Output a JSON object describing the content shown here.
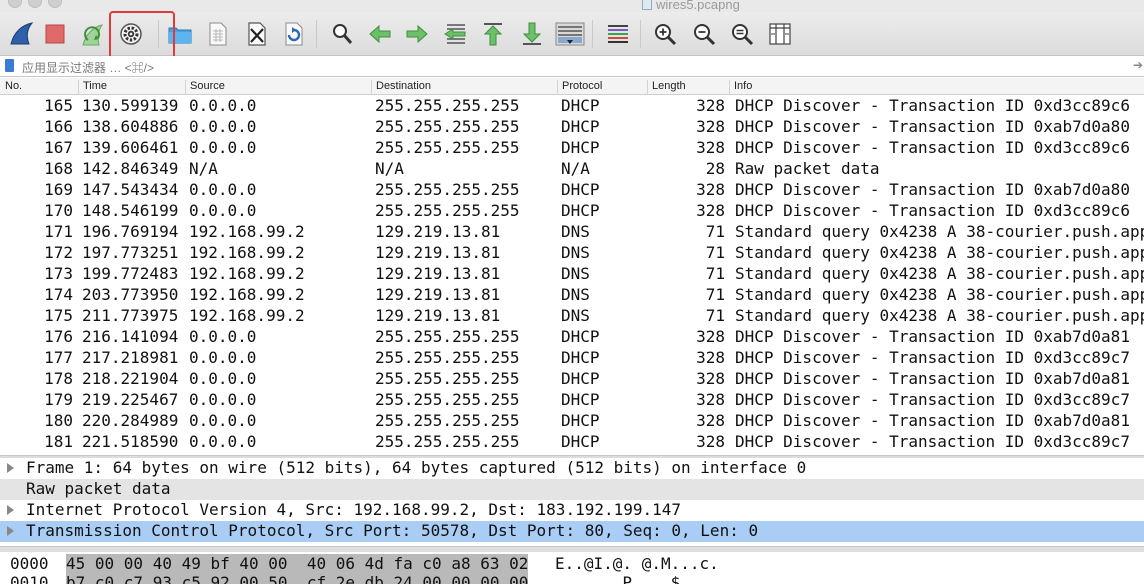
{
  "window": {
    "title": "wires5.pcapng"
  },
  "toolbar": {
    "buttons": [
      {
        "name": "start-capture-icon",
        "glyph": "shark-fin"
      },
      {
        "name": "stop-capture-icon",
        "glyph": "stop-square"
      },
      {
        "name": "restart-capture-icon",
        "glyph": "restart-fin"
      },
      {
        "name": "capture-options-icon",
        "glyph": "gear"
      },
      {
        "name": "open-file-icon",
        "glyph": "folder"
      },
      {
        "name": "save-file-icon",
        "glyph": "document"
      },
      {
        "name": "close-file-icon",
        "glyph": "document-x"
      },
      {
        "name": "reload-file-icon",
        "glyph": "document-reload"
      },
      {
        "name": "find-packet-icon",
        "glyph": "magnifier"
      },
      {
        "name": "go-back-icon",
        "glyph": "arrow-left"
      },
      {
        "name": "go-forward-icon",
        "glyph": "arrow-right"
      },
      {
        "name": "go-to-packet-icon",
        "glyph": "arrow-jump"
      },
      {
        "name": "go-first-packet-icon",
        "glyph": "arrow-up-top"
      },
      {
        "name": "go-last-packet-icon",
        "glyph": "arrow-down-bottom"
      },
      {
        "name": "auto-scroll-icon",
        "glyph": "list-scroll"
      },
      {
        "name": "colorize-icon",
        "glyph": "color-lines"
      },
      {
        "name": "zoom-in-icon",
        "glyph": "zoom-plus"
      },
      {
        "name": "zoom-out-icon",
        "glyph": "zoom-minus"
      },
      {
        "name": "normal-size-icon",
        "glyph": "zoom-equal"
      },
      {
        "name": "resize-columns-icon",
        "glyph": "columns"
      }
    ],
    "highlight_color": "#e23a3a"
  },
  "filter": {
    "placeholder": "应用显示过滤器 … <⌘/>"
  },
  "columns": {
    "no": "No.",
    "time": "Time",
    "source": "Source",
    "destination": "Destination",
    "protocol": "Protocol",
    "length": "Length",
    "info": "Info"
  },
  "packets": [
    {
      "no": "165",
      "time": "130.599139",
      "src": "0.0.0.0",
      "dst": "255.255.255.255",
      "proto": "DHCP",
      "len": "328",
      "info": "DHCP Discover - Transaction ID 0xd3cc89c6"
    },
    {
      "no": "166",
      "time": "138.604886",
      "src": "0.0.0.0",
      "dst": "255.255.255.255",
      "proto": "DHCP",
      "len": "328",
      "info": "DHCP Discover - Transaction ID 0xab7d0a80"
    },
    {
      "no": "167",
      "time": "139.606461",
      "src": "0.0.0.0",
      "dst": "255.255.255.255",
      "proto": "DHCP",
      "len": "328",
      "info": "DHCP Discover - Transaction ID 0xd3cc89c6"
    },
    {
      "no": "168",
      "time": "142.846349",
      "src": "N/A",
      "dst": "N/A",
      "proto": "N/A",
      "len": "28",
      "info": "Raw packet data"
    },
    {
      "no": "169",
      "time": "147.543434",
      "src": "0.0.0.0",
      "dst": "255.255.255.255",
      "proto": "DHCP",
      "len": "328",
      "info": "DHCP Discover - Transaction ID 0xab7d0a80"
    },
    {
      "no": "170",
      "time": "148.546199",
      "src": "0.0.0.0",
      "dst": "255.255.255.255",
      "proto": "DHCP",
      "len": "328",
      "info": "DHCP Discover - Transaction ID 0xd3cc89c6"
    },
    {
      "no": "171",
      "time": "196.769194",
      "src": "192.168.99.2",
      "dst": "129.219.13.81",
      "proto": "DNS",
      "len": "71",
      "info": "Standard query 0x4238 A 38-courier.push.app"
    },
    {
      "no": "172",
      "time": "197.773251",
      "src": "192.168.99.2",
      "dst": "129.219.13.81",
      "proto": "DNS",
      "len": "71",
      "info": "Standard query 0x4238 A 38-courier.push.app"
    },
    {
      "no": "173",
      "time": "199.772483",
      "src": "192.168.99.2",
      "dst": "129.219.13.81",
      "proto": "DNS",
      "len": "71",
      "info": "Standard query 0x4238 A 38-courier.push.app"
    },
    {
      "no": "174",
      "time": "203.773950",
      "src": "192.168.99.2",
      "dst": "129.219.13.81",
      "proto": "DNS",
      "len": "71",
      "info": "Standard query 0x4238 A 38-courier.push.app"
    },
    {
      "no": "175",
      "time": "211.773975",
      "src": "192.168.99.2",
      "dst": "129.219.13.81",
      "proto": "DNS",
      "len": "71",
      "info": "Standard query 0x4238 A 38-courier.push.app"
    },
    {
      "no": "176",
      "time": "216.141094",
      "src": "0.0.0.0",
      "dst": "255.255.255.255",
      "proto": "DHCP",
      "len": "328",
      "info": "DHCP Discover - Transaction ID 0xab7d0a81"
    },
    {
      "no": "177",
      "time": "217.218981",
      "src": "0.0.0.0",
      "dst": "255.255.255.255",
      "proto": "DHCP",
      "len": "328",
      "info": "DHCP Discover - Transaction ID 0xd3cc89c7"
    },
    {
      "no": "178",
      "time": "218.221904",
      "src": "0.0.0.0",
      "dst": "255.255.255.255",
      "proto": "DHCP",
      "len": "328",
      "info": "DHCP Discover - Transaction ID 0xab7d0a81"
    },
    {
      "no": "179",
      "time": "219.225467",
      "src": "0.0.0.0",
      "dst": "255.255.255.255",
      "proto": "DHCP",
      "len": "328",
      "info": "DHCP Discover - Transaction ID 0xd3cc89c7"
    },
    {
      "no": "180",
      "time": "220.284989",
      "src": "0.0.0.0",
      "dst": "255.255.255.255",
      "proto": "DHCP",
      "len": "328",
      "info": "DHCP Discover - Transaction ID 0xab7d0a81"
    },
    {
      "no": "181",
      "time": "221.518590",
      "src": "0.0.0.0",
      "dst": "255.255.255.255",
      "proto": "DHCP",
      "len": "328",
      "info": "DHCP Discover - Transaction ID 0xd3cc89c7"
    }
  ],
  "details": [
    {
      "text": "Frame 1: 64 bytes on wire (512 bits), 64 bytes captured (512 bits) on interface 0",
      "expandable": true,
      "style": "normal"
    },
    {
      "text": "Raw packet data",
      "expandable": false,
      "style": "gray"
    },
    {
      "text": "Internet Protocol Version 4, Src: 192.168.99.2, Dst: 183.192.199.147",
      "expandable": true,
      "style": "normal"
    },
    {
      "text": "Transmission Control Protocol, Src Port: 50578, Dst Port: 80, Seq: 0, Len: 0",
      "expandable": true,
      "style": "selected"
    }
  ],
  "bytes": [
    {
      "offset": "0000",
      "hex": "45 00 00 40 49 bf 40 00  40 06 4d fa c0 a8 63 02",
      "ascii": "E..@I.@. @.M...c."
    },
    {
      "offset": "0010",
      "hex": "b7 c0 c7 93 c5 92 00 50  cf 2e db 24 00 00 00 00",
      "ascii": ".......P ...$...."
    }
  ],
  "colors": {
    "selected_row": "#a9cdf5",
    "gray_row": "#e4e4e4",
    "bytes_highlight": "#b9b9b9"
  }
}
